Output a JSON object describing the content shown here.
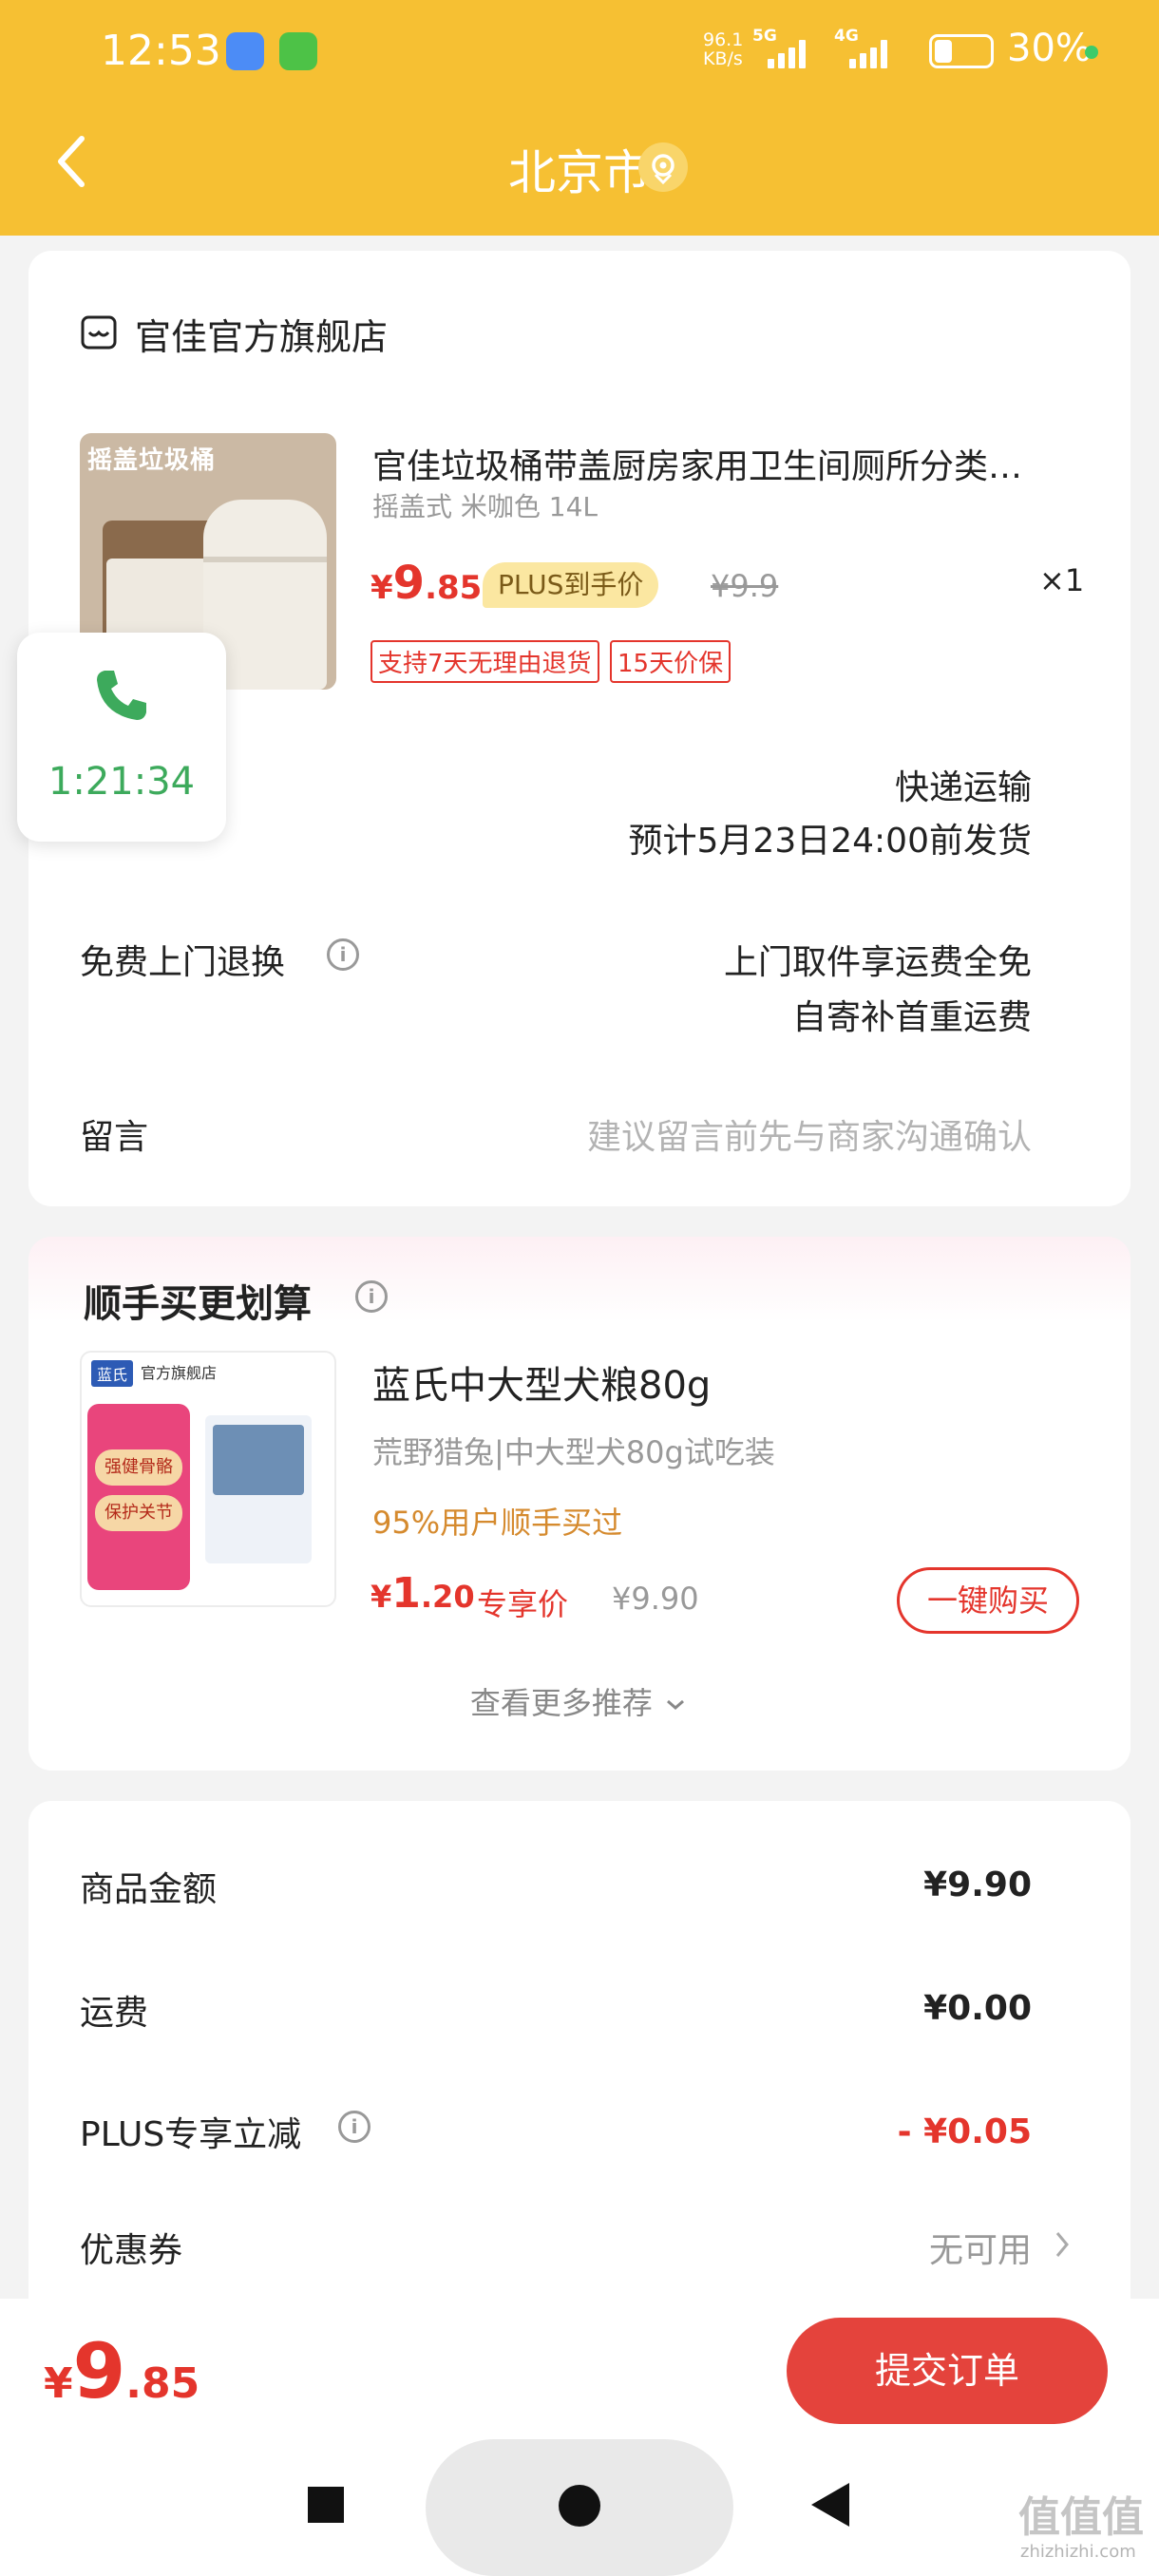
{
  "status_bar": {
    "time": "12:53",
    "net_speed": "96.1",
    "net_unit": "KB/s",
    "sig1": "5G",
    "sig2": "4G",
    "battery_pct": "30%"
  },
  "header": {
    "title": "北京市",
    "back_icon": "chevron-left-icon",
    "location_icon": "location-pin-icon"
  },
  "store": {
    "name": "官佳官方旗舰店"
  },
  "product": {
    "image_text": "摇盖垃圾桶",
    "title": "官佳垃圾桶带盖厨房家用卫生间厕所分类…",
    "spec": "摇盖式 米咖色 14L",
    "price_symbol": "¥",
    "price_int": "9",
    "price_dec": ".85",
    "plus_badge": "PLUS到手价",
    "orig_price": "¥9.9",
    "qty": "×1",
    "tags": [
      "支持7天无理由退货",
      "15天价保"
    ]
  },
  "call_overlay": {
    "timer": "1:21:34"
  },
  "shipping": {
    "method": "快递运输",
    "eta": "预计5月23日24:00前发货"
  },
  "return_service": {
    "label": "免费上门退换",
    "line1": "上门取件享运费全免",
    "line2": "自寄补首重运费"
  },
  "note": {
    "label": "留言",
    "placeholder": "建议留言前先与商家沟通确认"
  },
  "addon": {
    "section_title": "顺手买更划算",
    "img_brand": "蓝氏",
    "img_store": "官方旗舰店",
    "img_label1": "强健骨骼",
    "img_label2": "保护关节",
    "title": "蓝氏中大型犬粮80g",
    "subtitle": "荒野猎兔|中大型犬80g试吃装",
    "social": "95%用户顺手买过",
    "price_symbol": "¥",
    "price_int": "1",
    "price_dec": ".20",
    "price_label": "专享价",
    "orig_price": "¥9.90",
    "buy_button": "一键购买",
    "more": "查看更多推荐"
  },
  "summary": {
    "goods_label": "商品金额",
    "goods_value": "¥9.90",
    "shipping_label": "运费",
    "shipping_value": "¥0.00",
    "plus_label": "PLUS专享立减",
    "plus_value": "- ¥0.05",
    "coupon_label": "优惠券",
    "coupon_value": "无可用"
  },
  "footer": {
    "total_symbol": "¥",
    "total_int": "9",
    "total_dec": ".85",
    "submit": "提交订单"
  },
  "watermark": {
    "text": "值值值",
    "url": "zhizhizhi.com"
  },
  "colors": {
    "header": "#f6c033",
    "accent_red": "#e4352c",
    "submit": "#e4433c",
    "call_green": "#3daa5c"
  }
}
